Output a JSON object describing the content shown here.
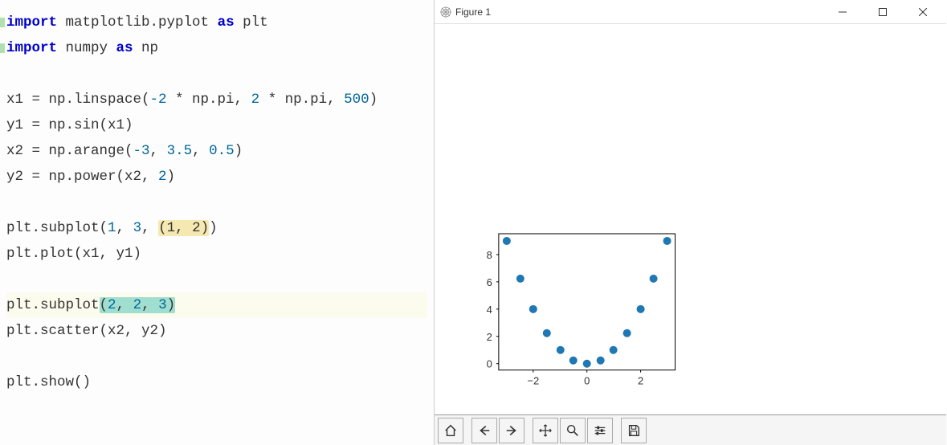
{
  "code": {
    "l1": {
      "pre": "import",
      "mid": " matplotlib.pyplot ",
      "as": "as",
      "post": " plt"
    },
    "l2": {
      "pre": "import",
      "mid": " numpy ",
      "as": "as",
      "post": " np"
    },
    "l4a": "x1 = np.linspace(",
    "l4b": "-2",
    "l4c": " * np.pi, ",
    "l4d": "2",
    "l4e": " * np.pi, ",
    "l4f": "500",
    "l4g": ")",
    "l5": "y1 = np.sin(x1)",
    "l6a": "x2 = np.arange(",
    "l6b": "-3",
    "l6c": ", ",
    "l6d": "3.5",
    "l6e": ", ",
    "l6f": "0.5",
    "l6g": ")",
    "l7a": "y2 = np.power(x2, ",
    "l7b": "2",
    "l7c": ")",
    "l9a": "plt.subplot(",
    "l9b": "1",
    "l9c": ", ",
    "l9d": "3",
    "l9e": ", ",
    "l9hl": "(1, 2)",
    "l9f": ")",
    "l10": "plt.plot(x1, y1)",
    "l12a": "plt.subplot",
    "l12p1": "(",
    "l12b": "2",
    "l12c": ", ",
    "l12d": "2",
    "l12e": ", ",
    "l12f": "3",
    "l12p2": ")",
    "l13": "plt.scatter(x2, y2)",
    "l15": "plt.show()"
  },
  "window": {
    "title": "Figure 1"
  },
  "axes": {
    "yticks": [
      "0",
      "2",
      "4",
      "6",
      "8"
    ],
    "xticks": [
      "−2",
      "0",
      "2"
    ]
  },
  "toolbar": {
    "home": "home-icon",
    "back": "back-icon",
    "forward": "forward-icon",
    "pan": "pan-icon",
    "zoom": "zoom-icon",
    "configure": "configure-icon",
    "save": "save-icon"
  },
  "chart_data": {
    "type": "scatter",
    "x": [
      -3.0,
      -2.5,
      -2.0,
      -1.5,
      -1.0,
      -0.5,
      0.0,
      0.5,
      1.0,
      1.5,
      2.0,
      2.5,
      3.0
    ],
    "y": [
      9.0,
      6.25,
      4.0,
      2.25,
      1.0,
      0.25,
      0.0,
      0.25,
      1.0,
      2.25,
      4.0,
      6.25,
      9.0
    ],
    "title": "",
    "xlabel": "",
    "ylabel": "",
    "xlim": [
      -3.3,
      3.3
    ],
    "ylim": [
      -0.5,
      9.5
    ],
    "xticks": [
      -2,
      0,
      2
    ],
    "yticks": [
      0,
      2,
      4,
      6,
      8
    ]
  }
}
